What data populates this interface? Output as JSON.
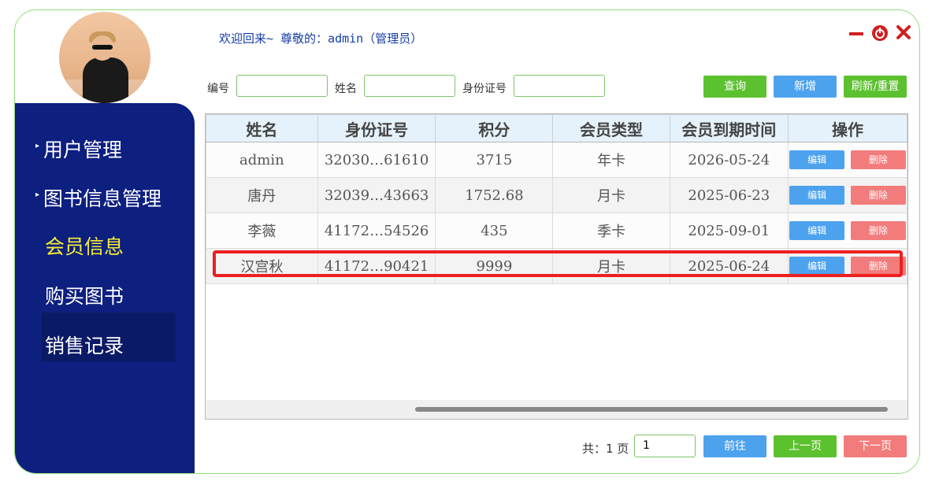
{
  "header": {
    "welcome": "欢迎回来~ 尊敬的：admin（管理员）"
  },
  "window_controls": {
    "minimize_icon": "minimize-icon",
    "power_icon": "power-icon",
    "close_icon": "close-icon"
  },
  "sidebar": {
    "items": [
      {
        "label": "用户管理",
        "arrow": true
      },
      {
        "label": "图书信息管理",
        "arrow": true
      },
      {
        "label": "会员信息",
        "arrow": false,
        "active": true
      },
      {
        "label": "购买图书",
        "arrow": false
      },
      {
        "label": "销售记录",
        "arrow": false
      }
    ],
    "active_color": "#f8ef31",
    "background": "#0d1f7f"
  },
  "search": {
    "id_label": "编号",
    "id_value": "",
    "name_label": "姓名",
    "name_value": "",
    "idcard_label": "身份证号",
    "idcard_value": "",
    "query_label": "查询",
    "add_label": "新增",
    "refresh_label": "刷新/重置"
  },
  "table": {
    "headers": [
      "姓名",
      "身份证号",
      "积分",
      "会员类型",
      "会员到期时间",
      "操作"
    ],
    "rows": [
      {
        "name": "admin",
        "idcard": "32030…61610",
        "points": "3715",
        "type": "年卡",
        "expiry": "2026-05-24"
      },
      {
        "name": "唐丹",
        "idcard": "32039…43663",
        "points": "1752.68",
        "type": "月卡",
        "expiry": "2025-06-23"
      },
      {
        "name": "李薇",
        "idcard": "41172…54526",
        "points": "435",
        "type": "季卡",
        "expiry": "2025-09-01"
      },
      {
        "name": "汉宫秋",
        "idcard": "41172…90421",
        "points": "9999",
        "type": "月卡",
        "expiry": "2025-06-24"
      }
    ],
    "edit_label": "编辑",
    "delete_label": "删除"
  },
  "pager": {
    "total_label": "共：1 页",
    "page_value": "1",
    "goto_label": "前往",
    "prev_label": "上一页",
    "next_label": "下一页"
  },
  "colors": {
    "green": "#5cc12f",
    "blue": "#4da2ee",
    "red": "#f27c7c",
    "header_bg": "#e6f2fb",
    "highlight_border": "#ee1f1f"
  }
}
